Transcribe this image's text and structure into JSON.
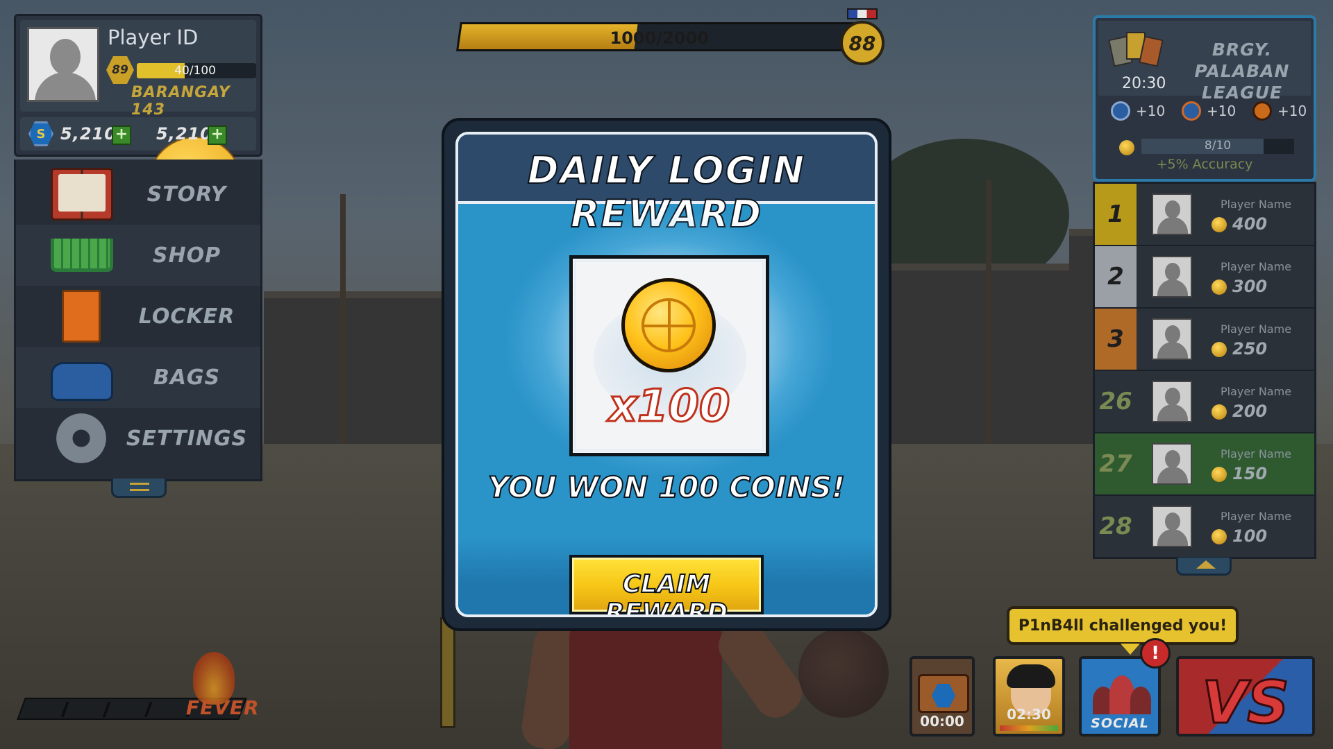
{
  "profile": {
    "player_id": "Player ID",
    "level": "89",
    "xp_text": "40/100",
    "xp_progress": 0.4,
    "barangay": "BARANGAY 143",
    "gems": "5,210",
    "coins": "5,210",
    "add_symbol": "+"
  },
  "menu": {
    "items": [
      {
        "label": "STORY",
        "icon": "book-icon"
      },
      {
        "label": "SHOP",
        "icon": "cart-icon"
      },
      {
        "label": "LOCKER",
        "icon": "locker-icon"
      },
      {
        "label": "BAGS",
        "icon": "bag-icon"
      },
      {
        "label": "SETTINGS",
        "icon": "gear-icon"
      }
    ]
  },
  "top_bar": {
    "progress_text": "1000/2000",
    "progress": 0.5,
    "rank": "88"
  },
  "league": {
    "timer": "20:30",
    "title": "BRGY. PALABAN LEAGUE",
    "bonuses": [
      "+10",
      "+10",
      "+10"
    ],
    "progress_text": "8/10",
    "progress": 0.8,
    "bonus_text": "+5% Accuracy"
  },
  "leaderboard": [
    {
      "rank": "1",
      "name": "Player Name",
      "score": "400",
      "style": "gold"
    },
    {
      "rank": "2",
      "name": "Player Name",
      "score": "300",
      "style": "silver"
    },
    {
      "rank": "3",
      "name": "Player Name",
      "score": "250",
      "style": "bronze"
    },
    {
      "rank": "26",
      "name": "Player Name",
      "score": "200",
      "style": "plain"
    },
    {
      "rank": "27",
      "name": "Player Name",
      "score": "150",
      "style": "me"
    },
    {
      "rank": "28",
      "name": "Player Name",
      "score": "100",
      "style": "plain"
    }
  ],
  "fever": {
    "label": "FEVER"
  },
  "bottom": {
    "challenge_text": "P1nB4ll challenged you!",
    "chest_timer": "00:00",
    "hero_timer": "02:30",
    "social_label": "SOCIAL",
    "alert": "!",
    "vs_label": "VS"
  },
  "modal": {
    "title": "DAILY LOGIN REWARD",
    "reward_quantity": "x100",
    "reward_text": "YOU WON 100 COINS!",
    "claim_label": "CLAIM REWARD"
  },
  "colors": {
    "accent_yellow": "#f6c516",
    "modal_blue": "#2a93c8",
    "header_navy": "#2d4a6a",
    "fever_orange": "#c0522a"
  }
}
